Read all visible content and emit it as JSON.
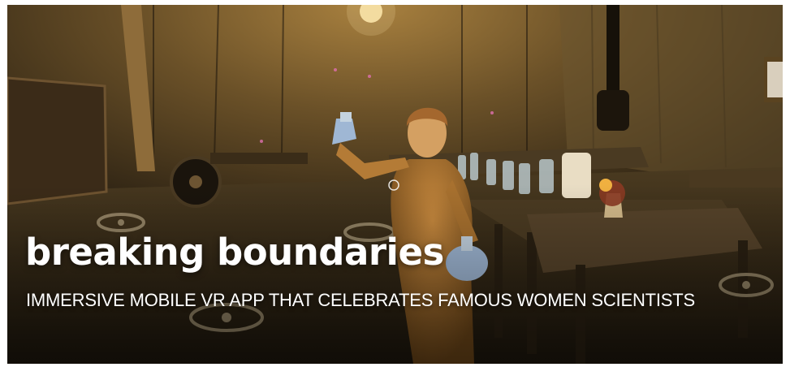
{
  "hero": {
    "title": "breaking boundaries",
    "subtitle": "IMMERSIVE MOBILE VR APP THAT CELEBRATES FAMOUS WOMEN SCIENTISTS",
    "scene_description_icon": "vr-laboratory-scene-image"
  },
  "colors": {
    "background": "#ffffff",
    "scene_dark": "#2a2114",
    "scene_warm": "#8a6a3a",
    "text": "#ffffff"
  }
}
